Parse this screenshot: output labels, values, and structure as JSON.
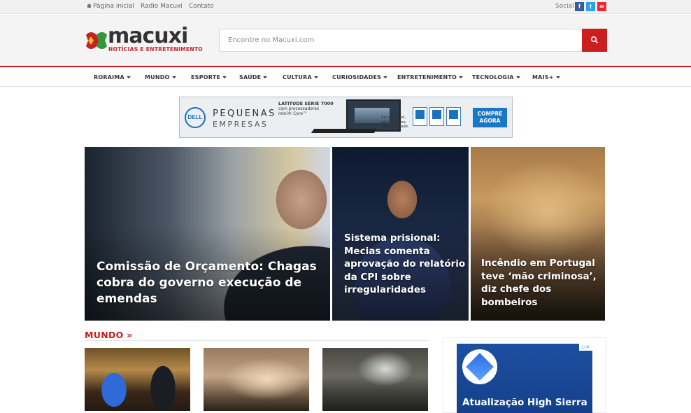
{
  "topbar": {
    "links": [
      "Página inicial",
      "Radio Macuxi",
      "Contato"
    ],
    "social_label": "Social",
    "social_icons": [
      "facebook-icon",
      "twitter-icon",
      "rss-icon"
    ]
  },
  "header": {
    "logo_text": "macuxi",
    "logo_tagline": "NOTÍCIAS E ENTRETENIMENTO",
    "search_placeholder": "Encontre no Macuxi.com"
  },
  "nav": {
    "items": [
      "RORAIMA",
      "MUNDO",
      "ESPORTE",
      "SAÚDE",
      "CULTURA",
      "CURIOSIDADES",
      "ENTRETENIMENTO",
      "TECNOLOGIA",
      "MAIS+"
    ]
  },
  "banner_ad": {
    "brand": "DELL",
    "headline_1": "PEQUENAS",
    "headline_2": "EMPRESAS",
    "series": "LATITUDE SÉRIE 7000",
    "processors": "com processadores Intel® Core™",
    "small_print": "Se tem Intel, tem máxima produtividade.",
    "cta": "COMPRE AGORA"
  },
  "featured": [
    {
      "title": "Comissão de Orçamento: Chagas cobra do governo execução de emendas"
    },
    {
      "title": "Sistema prisional: Mecias comenta aprovação do relatório da CPI sobre irregularidades"
    },
    {
      "title": "Incêndio em Portugal teve ‘mão criminosa’, diz chefe dos bombeiros"
    }
  ],
  "section": {
    "title": "MUNDO »"
  },
  "sidebar_ad": {
    "text": "Atualização High Sierra"
  },
  "colors": {
    "accent": "#c8171f",
    "search_button": "#cc1e1e",
    "section_title": "#c41d1d"
  }
}
